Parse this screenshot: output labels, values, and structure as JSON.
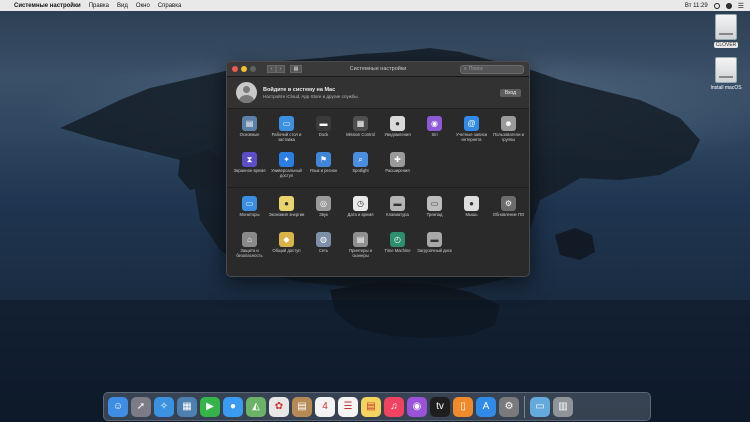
{
  "menubar": {
    "apple": "",
    "app_name": "Системные настройки",
    "items": [
      "Правка",
      "Вид",
      "Окно",
      "Справка"
    ],
    "clock": "Вт 11:29"
  },
  "desktop": {
    "drives": [
      {
        "label": "CLOVER",
        "selected": true
      },
      {
        "label": "Install macOS",
        "selected": false
      }
    ]
  },
  "window": {
    "title": "Системные настройки",
    "search_placeholder": "Поиск",
    "account": {
      "title": "Войдите в систему на Mac",
      "subtitle": "Настройте iCloud, App Store и другие службы.",
      "button": "Вход"
    },
    "section1": [
      {
        "label": "Основные",
        "icon": "general-icon",
        "color": "#5b7fa6",
        "glyph": "▤"
      },
      {
        "label": "Рабочий стол и заставка",
        "icon": "desktop-icon",
        "color": "#3d8fe0",
        "glyph": "▭"
      },
      {
        "label": "Dock",
        "icon": "dock-icon",
        "color": "#3a3a3a",
        "glyph": "▬"
      },
      {
        "label": "Mission Control",
        "icon": "mission-control-icon",
        "color": "#4f4f4f",
        "glyph": "▦"
      },
      {
        "label": "Уведомления",
        "icon": "notifications-icon",
        "color": "#d9d9d9",
        "glyph": "●"
      },
      {
        "label": "Siri",
        "icon": "siri-icon",
        "color": "#8e59d6",
        "glyph": "◉"
      },
      {
        "label": "Учетные записи интернета",
        "icon": "internet-accounts-icon",
        "color": "#2f8ae8",
        "glyph": "@"
      },
      {
        "label": "Пользователи и группы",
        "icon": "users-groups-icon",
        "color": "#9a9a9a",
        "glyph": "☻"
      },
      {
        "label": "Экранное время",
        "icon": "screen-time-icon",
        "color": "#5a4fc9",
        "glyph": "⧗"
      },
      {
        "label": "Универсальный доступ",
        "icon": "accessibility-icon",
        "color": "#2d7ee3",
        "glyph": "✦"
      },
      {
        "label": "Язык и регион",
        "icon": "language-region-icon",
        "color": "#3f86d7",
        "glyph": "⚑"
      },
      {
        "label": "Spotlight",
        "icon": "spotlight-icon",
        "color": "#4a8fdf",
        "glyph": "⌕"
      },
      {
        "label": "Расширения",
        "icon": "extensions-icon",
        "color": "#9a9a9a",
        "glyph": "✚"
      }
    ],
    "section2": [
      {
        "label": "Мониторы",
        "icon": "displays-icon",
        "color": "#3a8de0",
        "glyph": "▭"
      },
      {
        "label": "Экономия энергии",
        "icon": "energy-saver-icon",
        "color": "#e9d36c",
        "glyph": "●"
      },
      {
        "label": "Звук",
        "icon": "sound-icon",
        "color": "#9a9a9a",
        "glyph": "◎"
      },
      {
        "label": "Дата и время",
        "icon": "date-time-icon",
        "color": "#e9e9e9",
        "glyph": "◷"
      },
      {
        "label": "Клавиатура",
        "icon": "keyboard-icon",
        "color": "#b5b5b5",
        "glyph": "▬"
      },
      {
        "label": "Трекпад",
        "icon": "trackpad-icon",
        "color": "#bdbdbd",
        "glyph": "▭"
      },
      {
        "label": "Мышь",
        "icon": "mouse-icon",
        "color": "#dedede",
        "glyph": "●"
      },
      {
        "label": "Обновление ПО",
        "icon": "software-update-icon",
        "color": "#6c6c6c",
        "glyph": "⚙"
      },
      {
        "label": "Защита и безопасность",
        "icon": "security-privacy-icon",
        "color": "#8a8a8a",
        "glyph": "⌂"
      },
      {
        "label": "Общий доступ",
        "icon": "sharing-icon",
        "color": "#d9b34a",
        "glyph": "◆"
      },
      {
        "label": "Сеть",
        "icon": "network-icon",
        "color": "#7d8fa6",
        "glyph": "◍"
      },
      {
        "label": "Принтеры и сканеры",
        "icon": "printers-scanners-icon",
        "color": "#8f8f8f",
        "glyph": "▤"
      },
      {
        "label": "Time Machine",
        "icon": "time-machine-icon",
        "color": "#2e8f6e",
        "glyph": "◴"
      },
      {
        "label": "Загрузочный диск",
        "icon": "startup-disk-icon",
        "color": "#a8a8a8",
        "glyph": "▬"
      }
    ]
  },
  "dock": {
    "apps": [
      {
        "name": "finder-icon",
        "color": "#3d8de4",
        "glyph": "☺"
      },
      {
        "name": "launchpad-icon",
        "color": "#7c7c86",
        "glyph": "➚"
      },
      {
        "name": "safari-icon",
        "color": "#3a92e0",
        "glyph": "✧"
      },
      {
        "name": "photo-browser-icon",
        "color": "#4d7fb0",
        "glyph": "▦"
      },
      {
        "name": "facetime-icon",
        "color": "#35b44a",
        "glyph": "▶"
      },
      {
        "name": "messages-icon",
        "color": "#3a9cf0",
        "glyph": "●"
      },
      {
        "name": "maps-icon",
        "color": "#6cb36a",
        "glyph": "◭"
      },
      {
        "name": "photos-icon",
        "color": "#e7e7e7",
        "glyph": "✿"
      },
      {
        "name": "contacts-icon",
        "color": "#b58a57",
        "glyph": "▤"
      },
      {
        "name": "calendar-icon",
        "color": "#f3f3f3",
        "glyph": "4"
      },
      {
        "name": "reminders-icon",
        "color": "#f5f5f5",
        "glyph": "☰"
      },
      {
        "name": "notes-icon",
        "color": "#f4d35e",
        "glyph": "▤"
      },
      {
        "name": "music-icon",
        "color": "#f1425f",
        "glyph": "♫"
      },
      {
        "name": "podcasts-icon",
        "color": "#9a52d8",
        "glyph": "◉"
      },
      {
        "name": "tv-icon",
        "color": "#1e1e1e",
        "glyph": "tv"
      },
      {
        "name": "books-icon",
        "color": "#f08a2a",
        "glyph": "▯"
      },
      {
        "name": "app-store-icon",
        "color": "#2f8ae8",
        "glyph": "A"
      },
      {
        "name": "system-preferences-icon",
        "color": "#7a7a7a",
        "glyph": "⚙"
      },
      {
        "name": "downloads-folder-icon",
        "color": "#63a9dc",
        "glyph": "▭"
      },
      {
        "name": "trash-icon",
        "color": "#8f949a",
        "glyph": "▥"
      }
    ]
  }
}
